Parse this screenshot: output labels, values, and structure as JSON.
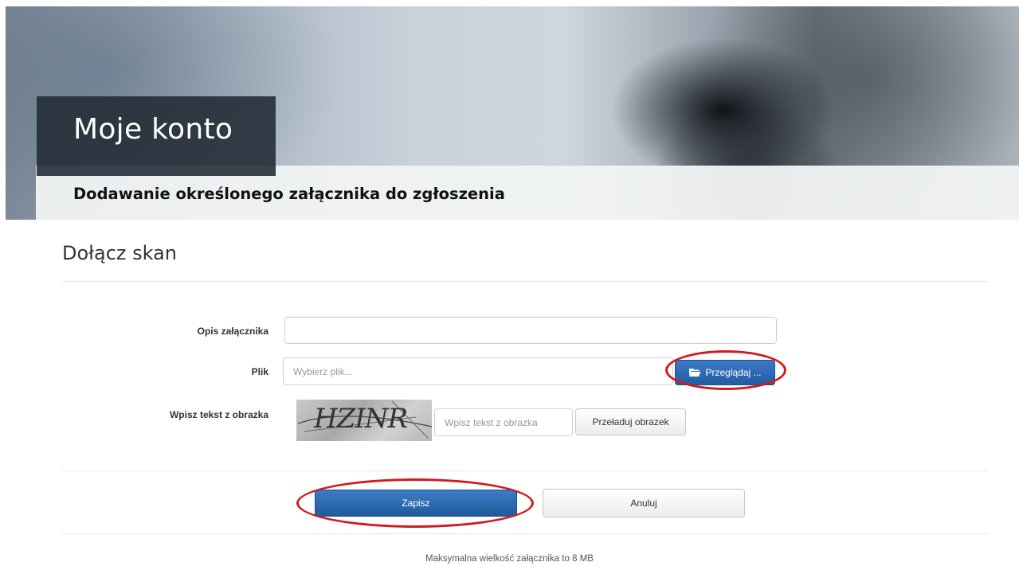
{
  "header": {
    "title": "Moje konto",
    "subtitle": "Dodawanie określonego załącznika do zgłoszenia"
  },
  "section": {
    "title": "Dołącz skan"
  },
  "form": {
    "description_label": "Opis załącznika",
    "description_value": "",
    "file_label": "Plik",
    "file_placeholder": "Wybierz plik...",
    "browse_label": "Przeglądaj ...",
    "captcha_label": "Wpisz tekst z obrazka",
    "captcha_image_text": "HZINR",
    "captcha_placeholder": "Wpisz tekst z obrazka",
    "reload_label": "Przeładuj obrazek"
  },
  "actions": {
    "save_label": "Zapisz",
    "cancel_label": "Anuluj"
  },
  "footer": {
    "note": "Maksymalna wielkość załącznika to 8 MB"
  },
  "colors": {
    "primary": "#2a67ad",
    "annotation": "#d11a1a",
    "title_box": "#202a34"
  },
  "icons": {
    "browse": "folder-open-icon"
  }
}
